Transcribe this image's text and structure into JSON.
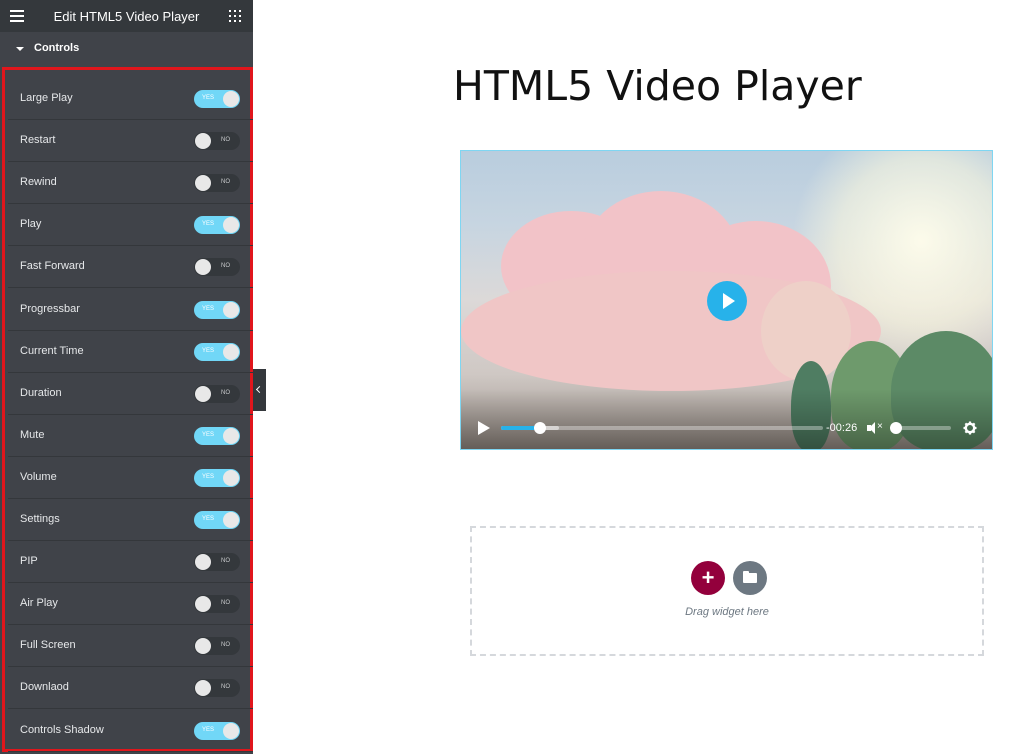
{
  "panel": {
    "title": "Edit HTML5 Video Player",
    "section_label": "Controls",
    "controls": [
      {
        "label": "Large Play",
        "state": "YES",
        "on": true
      },
      {
        "label": "Restart",
        "state": "NO",
        "on": false
      },
      {
        "label": "Rewind",
        "state": "NO",
        "on": false
      },
      {
        "label": "Play",
        "state": "YES",
        "on": true
      },
      {
        "label": "Fast Forward",
        "state": "NO",
        "on": false
      },
      {
        "label": "Progressbar",
        "state": "YES",
        "on": true
      },
      {
        "label": "Current Time",
        "state": "YES",
        "on": true
      },
      {
        "label": "Duration",
        "state": "NO",
        "on": false
      },
      {
        "label": "Mute",
        "state": "YES",
        "on": true
      },
      {
        "label": "Volume",
        "state": "YES",
        "on": true
      },
      {
        "label": "Settings",
        "state": "YES",
        "on": true
      },
      {
        "label": "PIP",
        "state": "NO",
        "on": false
      },
      {
        "label": "Air Play",
        "state": "NO",
        "on": false
      },
      {
        "label": "Full Screen",
        "state": "NO",
        "on": false
      },
      {
        "label": "Downlaod",
        "state": "NO",
        "on": false
      },
      {
        "label": "Controls Shadow",
        "state": "YES",
        "on": true
      }
    ]
  },
  "page": {
    "heading": "HTML5 Video Player"
  },
  "player": {
    "time": "-00:26",
    "progress_fraction": 0.12,
    "buffered_fraction": 0.18,
    "volume_fraction": 0.05,
    "accent": "#27b2ea"
  },
  "dropzone": {
    "add_label": "+",
    "text": "Drag widget here"
  },
  "colors": {
    "panel_bg": "#404349",
    "topbar_bg": "#34383c",
    "toggle_on": "#71d7f7",
    "highlight_border": "#e0161c",
    "add_button": "#93003c",
    "folder_button": "#6d7882"
  }
}
